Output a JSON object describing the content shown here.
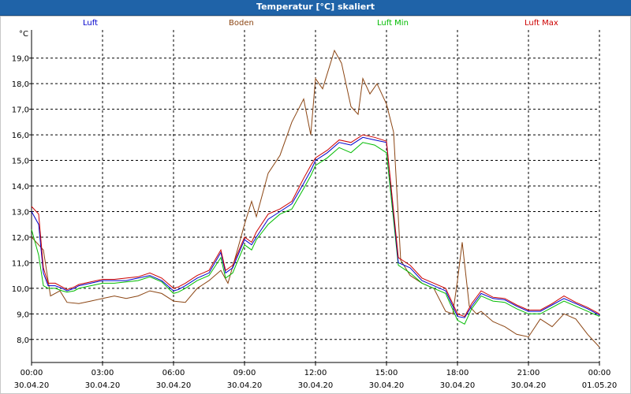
{
  "window": {
    "title": "Temperatur [°C] skaliert"
  },
  "chart_data": {
    "type": "line",
    "title": "Temperatur [°C] skaliert",
    "ylabel": "°C",
    "xlabel": "",
    "grid": true,
    "ylim": [
      7.1,
      20.1
    ],
    "xlim": [
      0,
      24
    ],
    "y_ticks": [
      "8,0",
      "9,0",
      "10,0",
      "11,0",
      "12,0",
      "13,0",
      "14,0",
      "15,0",
      "16,0",
      "17,0",
      "18,0",
      "19,0"
    ],
    "x_ticks": [
      {
        "time": "00:00",
        "date": "30.04.20"
      },
      {
        "time": "03:00",
        "date": "30.04.20"
      },
      {
        "time": "06:00",
        "date": "30.04.20"
      },
      {
        "time": "09:00",
        "date": "30.04.20"
      },
      {
        "time": "12:00",
        "date": "30.04.20"
      },
      {
        "time": "15:00",
        "date": "30.04.20"
      },
      {
        "time": "18:00",
        "date": "30.04.20"
      },
      {
        "time": "21:00",
        "date": "30.04.20"
      },
      {
        "time": "00:00",
        "date": "01.05.20"
      }
    ],
    "legend": [
      "Luft",
      "Boden",
      "Luft Min",
      "Luft Max"
    ],
    "series": [
      {
        "name": "Luft",
        "color": "#0000cc",
        "x": [
          0,
          0.3,
          0.5,
          0.7,
          1,
          1.3,
          1.5,
          1.8,
          2,
          2.5,
          3,
          3.5,
          4,
          4.5,
          5,
          5.5,
          6,
          6.2,
          6.5,
          7,
          7.5,
          8,
          8.2,
          8.5,
          9,
          9.3,
          9.5,
          10,
          10.5,
          11,
          11.5,
          11.8,
          12,
          12.5,
          13,
          13.5,
          14,
          14.5,
          15,
          15.5,
          16,
          16.5,
          17,
          17.5,
          18,
          18.3,
          18.6,
          19,
          19.5,
          20,
          20.5,
          21,
          21.5,
          22,
          22.5,
          23,
          23.5,
          24
        ],
        "y": [
          13.0,
          12.5,
          10.6,
          10.1,
          10.1,
          10.0,
          9.9,
          10.0,
          10.1,
          10.2,
          10.3,
          10.3,
          10.3,
          10.4,
          10.5,
          10.3,
          9.9,
          9.95,
          10.1,
          10.4,
          10.6,
          11.4,
          10.6,
          10.8,
          11.9,
          11.7,
          12.0,
          12.7,
          13.0,
          13.3,
          14.1,
          14.6,
          15.0,
          15.3,
          15.7,
          15.6,
          15.9,
          15.8,
          15.7,
          11.0,
          10.8,
          10.3,
          10.1,
          9.9,
          8.9,
          8.85,
          9.3,
          9.8,
          9.6,
          9.55,
          9.3,
          9.1,
          9.1,
          9.35,
          9.6,
          9.4,
          9.2,
          8.95
        ]
      },
      {
        "name": "Boden",
        "color": "#8b4513",
        "x": [
          0,
          0.5,
          0.8,
          1.2,
          1.5,
          2,
          2.5,
          3,
          3.5,
          4,
          4.5,
          5,
          5.5,
          6,
          6.5,
          7,
          7.5,
          8,
          8.3,
          8.7,
          9,
          9.3,
          9.5,
          10,
          10.5,
          11,
          11.5,
          11.8,
          12,
          12.3,
          12.8,
          13.1,
          13.5,
          13.8,
          14,
          14.3,
          14.6,
          15,
          15.3,
          15.6,
          16,
          16.5,
          17,
          17.5,
          17.8,
          18,
          18.2,
          18.5,
          18.8,
          19,
          19.5,
          20,
          20.5,
          21,
          21.5,
          22,
          22.5,
          23,
          23.5,
          24
        ],
        "y": [
          12.0,
          11.5,
          9.7,
          9.9,
          9.45,
          9.4,
          9.5,
          9.6,
          9.7,
          9.6,
          9.7,
          9.9,
          9.8,
          9.5,
          9.45,
          10.0,
          10.3,
          10.7,
          10.2,
          11.5,
          12.5,
          13.4,
          12.8,
          14.5,
          15.2,
          16.5,
          17.4,
          16.0,
          18.2,
          17.8,
          19.3,
          18.8,
          17.1,
          16.8,
          18.2,
          17.6,
          18.0,
          17.2,
          16.1,
          11.1,
          10.5,
          10.2,
          10.0,
          9.1,
          9.0,
          10.3,
          11.8,
          9.3,
          9.0,
          9.1,
          8.7,
          8.5,
          8.2,
          8.1,
          8.8,
          8.5,
          9.0,
          8.8,
          8.2,
          7.7
        ]
      },
      {
        "name": "Luft Min",
        "color": "#00bb00",
        "x": [
          0,
          0.3,
          0.5,
          0.7,
          1,
          1.3,
          1.5,
          1.8,
          2,
          2.5,
          3,
          3.5,
          4,
          4.5,
          5,
          5.5,
          6,
          6.2,
          6.5,
          7,
          7.5,
          8,
          8.2,
          8.5,
          9,
          9.3,
          9.5,
          10,
          10.5,
          11,
          11.5,
          11.8,
          12,
          12.5,
          13,
          13.5,
          14,
          14.5,
          15,
          15.5,
          16,
          16.5,
          17,
          17.5,
          18,
          18.3,
          18.6,
          19,
          19.5,
          20,
          20.5,
          21,
          21.5,
          22,
          22.5,
          23,
          23.5,
          24
        ],
        "y": [
          12.3,
          11.3,
          10.1,
          10.0,
          10.0,
          9.9,
          9.85,
          9.9,
          10.0,
          10.1,
          10.2,
          10.2,
          10.25,
          10.3,
          10.45,
          10.25,
          9.8,
          9.85,
          10.0,
          10.3,
          10.5,
          11.2,
          10.4,
          10.6,
          11.7,
          11.5,
          11.9,
          12.5,
          12.9,
          13.1,
          13.9,
          14.4,
          14.8,
          15.1,
          15.5,
          15.3,
          15.7,
          15.6,
          15.3,
          10.9,
          10.6,
          10.2,
          10.0,
          9.8,
          8.75,
          8.6,
          9.2,
          9.7,
          9.5,
          9.45,
          9.2,
          9.0,
          9.0,
          9.25,
          9.5,
          9.3,
          9.1,
          8.9
        ]
      },
      {
        "name": "Luft Max",
        "color": "#cc0000",
        "x": [
          0,
          0.3,
          0.5,
          0.7,
          1,
          1.3,
          1.5,
          1.8,
          2,
          2.5,
          3,
          3.5,
          4,
          4.5,
          5,
          5.5,
          6,
          6.2,
          6.5,
          7,
          7.5,
          8,
          8.2,
          8.5,
          9,
          9.3,
          9.5,
          10,
          10.5,
          11,
          11.5,
          11.8,
          12,
          12.5,
          13,
          13.5,
          14,
          14.5,
          15,
          15.5,
          16,
          16.5,
          17,
          17.5,
          18,
          18.3,
          18.6,
          19,
          19.5,
          20,
          20.5,
          21,
          21.5,
          22,
          22.5,
          23,
          23.5,
          24
        ],
        "y": [
          13.2,
          12.9,
          10.8,
          10.2,
          10.2,
          10.05,
          9.95,
          10.05,
          10.15,
          10.25,
          10.35,
          10.35,
          10.4,
          10.45,
          10.6,
          10.4,
          10.0,
          10.05,
          10.2,
          10.5,
          10.7,
          11.5,
          10.7,
          10.9,
          12.0,
          11.8,
          12.2,
          12.9,
          13.1,
          13.4,
          14.3,
          14.8,
          15.1,
          15.4,
          15.8,
          15.7,
          16.0,
          15.9,
          15.75,
          11.2,
          10.9,
          10.4,
          10.2,
          10.0,
          9.0,
          8.9,
          9.4,
          9.9,
          9.65,
          9.6,
          9.35,
          9.15,
          9.15,
          9.4,
          9.7,
          9.45,
          9.25,
          9.0
        ]
      }
    ]
  }
}
